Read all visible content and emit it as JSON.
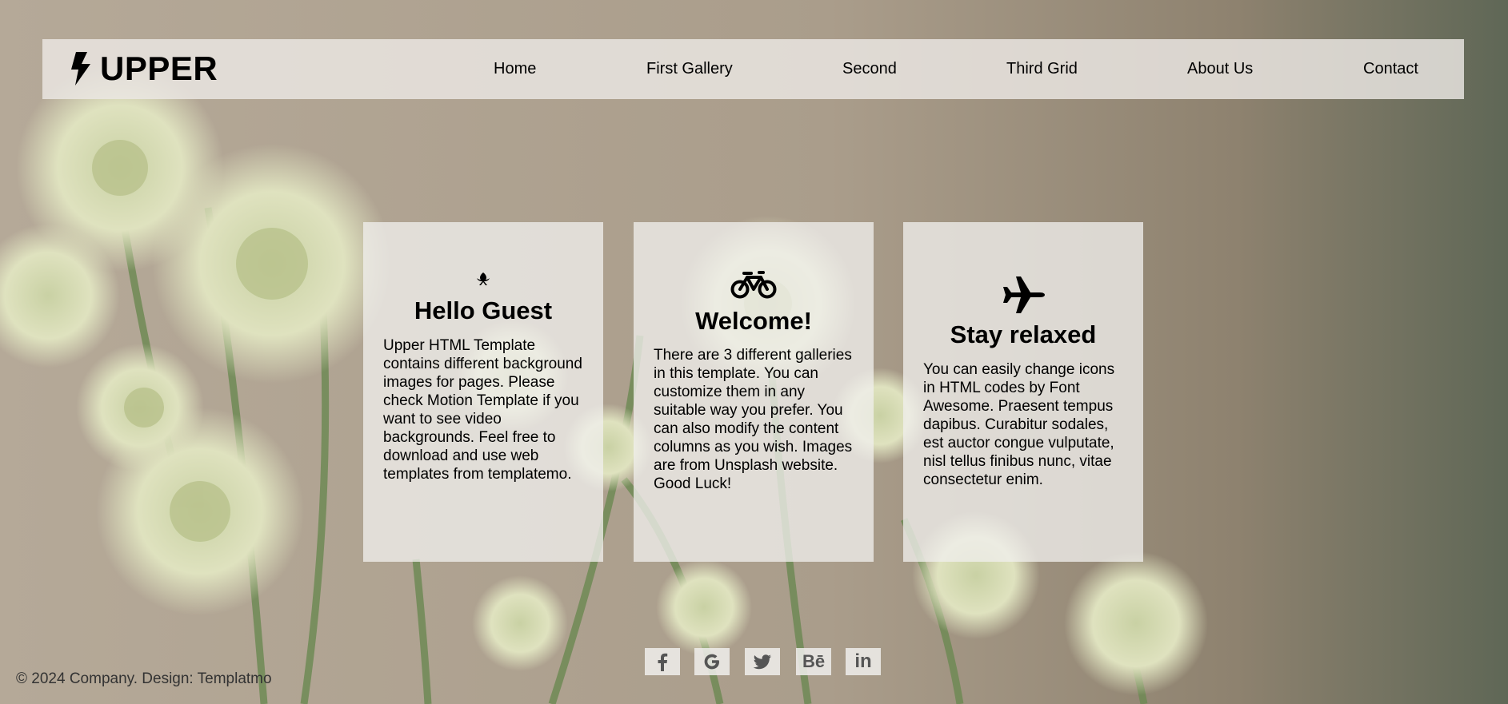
{
  "brand": {
    "name": "UPPER",
    "icon": "bolt-icon"
  },
  "nav": {
    "items": [
      {
        "label": "Home"
      },
      {
        "label": "First Gallery"
      },
      {
        "label": "Second"
      },
      {
        "label": "Third Grid"
      },
      {
        "label": "About Us"
      },
      {
        "label": "Contact"
      }
    ]
  },
  "cards": [
    {
      "icon": "leaf-icon",
      "title": "Hello Guest",
      "text": "Upper HTML Template contains different background images for pages. Please check Motion Template if you want to see video backgrounds. Feel free to download and use web templates from templatemo."
    },
    {
      "icon": "bicycle-icon",
      "title": "Welcome!",
      "text": "There are 3 different galleries in this template. You can customize them in any suitable way you prefer. You can also modify the content columns as you wish. Images are from Unsplash website. Good Luck!"
    },
    {
      "icon": "plane-icon",
      "title": "Stay relaxed",
      "text": "You can easily change icons in HTML codes by Font Awesome. Praesent tempus dapibus. Curabitur sodales, est auctor congue vulputate, nisl tellus finibus nunc, vitae consectetur enim."
    }
  ],
  "footer": {
    "copyright": "© 2024 Company. Design: Templatmo",
    "social": [
      {
        "icon": "facebook-icon",
        "glyph": "f"
      },
      {
        "icon": "google-icon",
        "glyph": "G"
      },
      {
        "icon": "twitter-icon",
        "glyph": ""
      },
      {
        "icon": "behance-icon",
        "glyph": "Bē"
      },
      {
        "icon": "linkedin-icon",
        "glyph": "in"
      }
    ]
  },
  "colors": {
    "panel": "#ebe8e4",
    "text": "#000000",
    "footer_text": "#333333",
    "background": "#ada18f",
    "social_icon": "#555555"
  }
}
